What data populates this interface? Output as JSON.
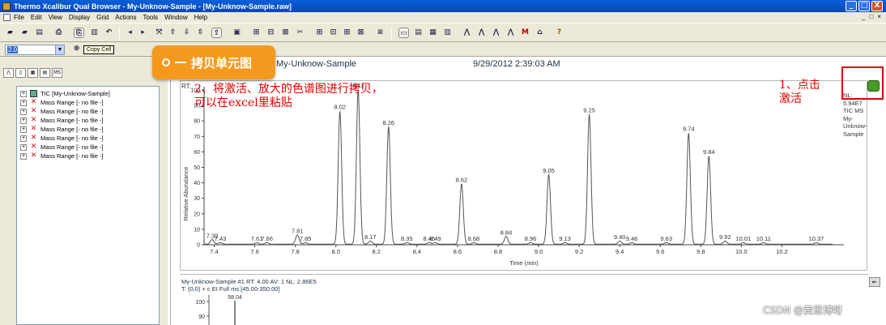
{
  "window": {
    "title": "Thermo Xcalibur Qual Browser - My-Unknow-Sample - [My-Unknow-Sample.raw]",
    "controls": [
      "_",
      "□",
      "X"
    ]
  },
  "menu": [
    "File",
    "Edit",
    "View",
    "Display",
    "Grid",
    "Actions",
    "Tools",
    "Window",
    "Help"
  ],
  "mdi_controls": [
    "_",
    "□",
    "×"
  ],
  "toolbar2": {
    "combo_value": "2.0",
    "tooltip": "Copy Cell"
  },
  "callout": {
    "label": "拷贝单元图"
  },
  "tree": {
    "items": [
      {
        "label": "TIC [My-Unknow-Sample]",
        "icon": "tic-icon"
      },
      {
        "label": "Mass Range [- no file -]",
        "icon": "x-icon"
      },
      {
        "label": "Mass Range [- no file -]",
        "icon": "x-icon"
      },
      {
        "label": "Mass Range [- no file -]",
        "icon": "x-icon"
      },
      {
        "label": "Mass Range [- no file -]",
        "icon": "x-icon"
      },
      {
        "label": "Mass Range [- no file -]",
        "icon": "x-icon"
      },
      {
        "label": "Mass Range [- no file -]",
        "icon": "x-icon"
      },
      {
        "label": "Mass Range [- no file -]",
        "icon": "x-icon"
      }
    ]
  },
  "header": {
    "sample": "My-Unknow-Sample",
    "datetime": "9/29/2012 2:39:03 AM"
  },
  "annotations": {
    "step2": [
      "2、将激活、放大的色谱图进行拷贝，",
      "可以在excel里粘贴"
    ],
    "step1": [
      "1、点击",
      "激活"
    ]
  },
  "nl_block": [
    "NL:",
    "5.94E7",
    "TIC  MS",
    "My-",
    "Unknow-",
    "Sample"
  ],
  "rt_label": "RT:",
  "spectrum": {
    "header_line1": "My-Unknow-Sample #1   RT: 4.00   AV: 1   NL: 2.86E5",
    "header_line2": "T: {0,0}  + c EI Full ms [45.00-350.00]",
    "top_peak": "58.04",
    "y_ticks": [
      "100",
      "90"
    ]
  },
  "watermark": "CSDN @黄思博呀",
  "chart_data": {
    "type": "line",
    "xlabel": "Time (min)",
    "ylabel": "Relative Abundance",
    "xlim": [
      7.35,
      10.45
    ],
    "ylim": [
      0,
      100
    ],
    "x_ticks": [
      7.4,
      7.6,
      7.8,
      8.0,
      8.2,
      8.4,
      8.6,
      8.8,
      9.0,
      9.2,
      9.4,
      9.6,
      9.8,
      10.0,
      10.2
    ],
    "y_ticks": [
      0,
      10,
      20,
      30,
      40,
      50,
      60,
      70,
      80,
      90,
      100
    ],
    "peaks": [
      {
        "rt": 7.39,
        "height": 3,
        "label": "7.39"
      },
      {
        "rt": 7.43,
        "height": 1,
        "label": "7.43"
      },
      {
        "rt": 7.61,
        "height": 1,
        "label": "7.61"
      },
      {
        "rt": 7.66,
        "height": 1,
        "label": "7.66"
      },
      {
        "rt": 7.81,
        "height": 6,
        "label": "7.81"
      },
      {
        "rt": 7.85,
        "height": 1,
        "label": "7.85"
      },
      {
        "rt": 8.02,
        "height": 86,
        "label": "8.02"
      },
      {
        "rt": 8.11,
        "height": 100,
        "label": "8.11"
      },
      {
        "rt": 8.17,
        "height": 2,
        "label": "8.17"
      },
      {
        "rt": 8.26,
        "height": 76,
        "label": "8.26"
      },
      {
        "rt": 8.35,
        "height": 1,
        "label": "8.35"
      },
      {
        "rt": 8.46,
        "height": 1,
        "label": "8.46"
      },
      {
        "rt": 8.49,
        "height": 1,
        "label": "8.49"
      },
      {
        "rt": 8.62,
        "height": 39,
        "label": "8.62"
      },
      {
        "rt": 8.68,
        "height": 1,
        "label": "8.68"
      },
      {
        "rt": 8.84,
        "height": 5,
        "label": "8.84"
      },
      {
        "rt": 8.96,
        "height": 1,
        "label": "8.96"
      },
      {
        "rt": 9.05,
        "height": 45,
        "label": "9.05"
      },
      {
        "rt": 9.13,
        "height": 1,
        "label": "9.13"
      },
      {
        "rt": 9.25,
        "height": 84,
        "label": "9.25"
      },
      {
        "rt": 9.4,
        "height": 2,
        "label": "9.40"
      },
      {
        "rt": 9.46,
        "height": 1,
        "label": "9.46"
      },
      {
        "rt": 9.63,
        "height": 1,
        "label": "9.63"
      },
      {
        "rt": 9.74,
        "height": 72,
        "label": "9.74"
      },
      {
        "rt": 9.84,
        "height": 57,
        "label": "9.84"
      },
      {
        "rt": 9.92,
        "height": 2,
        "label": "9.92"
      },
      {
        "rt": 10.01,
        "height": 1,
        "label": "10.01"
      },
      {
        "rt": 10.11,
        "height": 1,
        "label": "10.11"
      },
      {
        "rt": 10.37,
        "height": 1,
        "label": "10.37"
      }
    ]
  }
}
